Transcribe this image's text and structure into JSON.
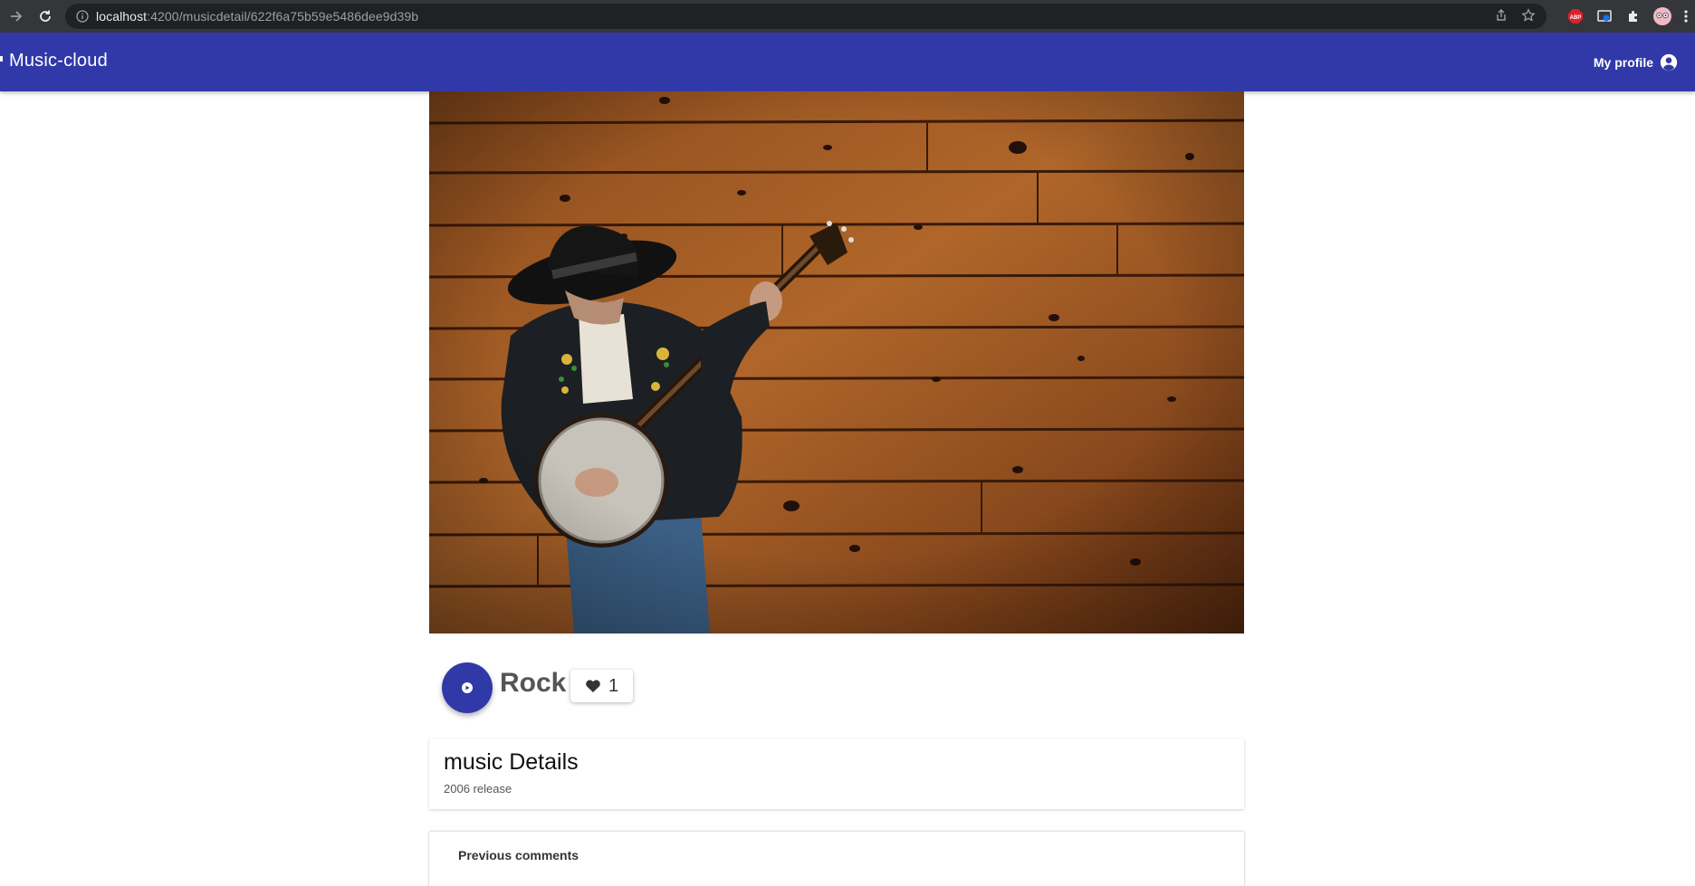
{
  "browser": {
    "url_host": "localhost",
    "url_path": ":4200/musicdetail/622f6a75b59e5486dee9d39b"
  },
  "app": {
    "brand": "Music-cloud",
    "profile_label": "My profile",
    "accent_color": "#3139a8"
  },
  "track": {
    "genre": "Rock",
    "likes": "1"
  },
  "details": {
    "title": "music Details",
    "subtitle": "2006 release"
  },
  "comments": {
    "title": "Previous comments"
  },
  "icons": {
    "back": "arrow-right-icon",
    "reload": "reload-icon",
    "info": "info-icon",
    "share": "share-icon",
    "bookmark": "star-icon",
    "abp": "adblock-icon",
    "ext": "extension-icon",
    "puzzle": "puzzle-icon",
    "avatar": "avatar-icon",
    "menu": "kebab-menu-icon",
    "profile": "account-circle-icon",
    "play": "play-icon",
    "heart": "heart-icon"
  }
}
